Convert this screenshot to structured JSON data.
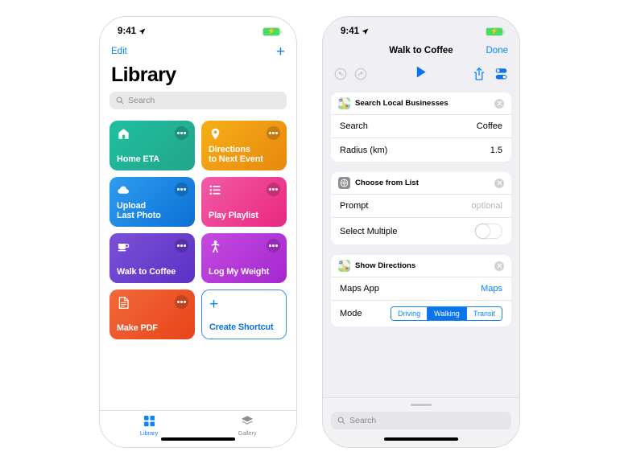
{
  "phone_left": {
    "status": {
      "time": "9:41",
      "location_icon": "location-arrow-icon",
      "battery_icon": "battery-charging-icon"
    },
    "nav": {
      "edit_label": "Edit",
      "add_icon": "plus-icon"
    },
    "title": "Library",
    "search": {
      "placeholder": "Search",
      "icon": "search-icon"
    },
    "tiles": [
      {
        "label": "Home ETA",
        "icon": "home-icon",
        "color_start": "#1fbfa0",
        "color_end": "#23a58c",
        "menu_icon": "ellipsis-icon"
      },
      {
        "label": "Directions\nto Next Event",
        "icon": "map-pin-icon",
        "color_start": "#f5b016",
        "color_end": "#e8870f",
        "menu_icon": "ellipsis-icon"
      },
      {
        "label": "Upload\nLast Photo",
        "icon": "cloud-icon",
        "color_start": "#2e9df0",
        "color_end": "#0b6fd4",
        "menu_icon": "ellipsis-icon"
      },
      {
        "label": "Play Playlist",
        "icon": "list-icon",
        "color_start": "#f45ba8",
        "color_end": "#e8277f",
        "menu_icon": "ellipsis-icon"
      },
      {
        "label": "Walk to Coffee",
        "icon": "coffee-cup-icon",
        "color_start": "#7b52d6",
        "color_end": "#5c2fc4",
        "menu_icon": "ellipsis-icon"
      },
      {
        "label": "Log My Weight",
        "icon": "accessibility-icon",
        "color_start": "#c44ae0",
        "color_end": "#a428cf",
        "menu_icon": "ellipsis-icon"
      },
      {
        "label": "Make PDF",
        "icon": "document-icon",
        "color_start": "#f1693a",
        "color_end": "#e8431a",
        "menu_icon": "ellipsis-icon"
      }
    ],
    "create_tile": {
      "label": "Create Shortcut",
      "icon": "plus-icon",
      "border_color": "#3d8ce0"
    },
    "tabs": [
      {
        "label": "Library",
        "icon": "grid-squares-icon",
        "active": true
      },
      {
        "label": "Gallery",
        "icon": "layers-icon",
        "active": false
      }
    ]
  },
  "phone_right": {
    "status": {
      "time": "9:41",
      "location_icon": "location-arrow-icon",
      "battery_icon": "battery-charging-icon"
    },
    "nav": {
      "title": "Walk to Coffee",
      "done_label": "Done"
    },
    "toolbar": {
      "undo_icon": "undo-circle-icon",
      "redo_icon": "redo-circle-icon",
      "play_icon": "play-triangle-icon",
      "share_icon": "share-box-icon",
      "settings_icon": "sliders-toggle-icon"
    },
    "cards": [
      {
        "title": "Search Local Businesses",
        "icon": "maps-app-icon",
        "close_icon": "close-circle-icon",
        "rows": [
          {
            "label": "Search",
            "value": "Coffee",
            "type": "text"
          },
          {
            "label": "Radius (km)",
            "value": "1.5",
            "type": "text"
          }
        ]
      },
      {
        "title": "Choose from List",
        "icon": "gear-icon",
        "close_icon": "close-circle-icon",
        "rows": [
          {
            "label": "Prompt",
            "value": "optional",
            "type": "placeholder"
          },
          {
            "label": "Select Multiple",
            "value": "",
            "type": "toggle",
            "toggle_on": false
          }
        ]
      },
      {
        "title": "Show Directions",
        "icon": "maps-app-icon",
        "close_icon": "close-circle-icon",
        "rows": [
          {
            "label": "Maps App",
            "value": "Maps",
            "type": "link"
          },
          {
            "label": "Mode",
            "value": "",
            "type": "segmented",
            "segments": [
              "Driving",
              "Walking",
              "Transit"
            ],
            "selected": "Walking"
          }
        ]
      }
    ],
    "bottom_sheet": {
      "search_placeholder": "Search",
      "search_icon": "search-icon",
      "grabber": "drag-grabber"
    }
  },
  "colors": {
    "accent_blue": "#0a84ff",
    "segment_on": "#0a74e8",
    "page_bg": "#ffffff",
    "editor_bg": "#efeff4"
  }
}
